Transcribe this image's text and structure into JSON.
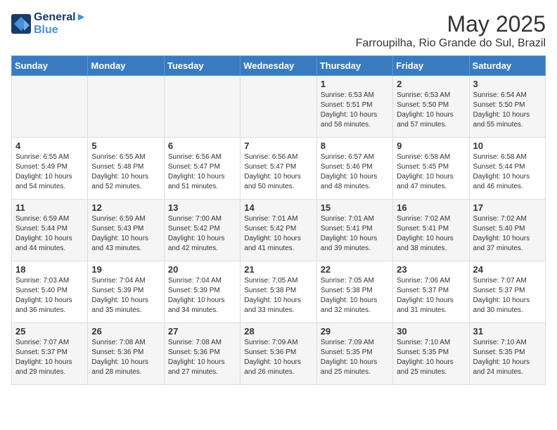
{
  "header": {
    "logo_line1": "General",
    "logo_line2": "Blue",
    "title": "May 2025",
    "subtitle": "Farroupilha, Rio Grande do Sul, Brazil"
  },
  "days_of_week": [
    "Sunday",
    "Monday",
    "Tuesday",
    "Wednesday",
    "Thursday",
    "Friday",
    "Saturday"
  ],
  "weeks": [
    [
      {
        "day": "",
        "info": ""
      },
      {
        "day": "",
        "info": ""
      },
      {
        "day": "",
        "info": ""
      },
      {
        "day": "",
        "info": ""
      },
      {
        "day": "1",
        "info": "Sunrise: 6:53 AM\nSunset: 5:51 PM\nDaylight: 10 hours\nand 58 minutes."
      },
      {
        "day": "2",
        "info": "Sunrise: 6:53 AM\nSunset: 5:50 PM\nDaylight: 10 hours\nand 57 minutes."
      },
      {
        "day": "3",
        "info": "Sunrise: 6:54 AM\nSunset: 5:50 PM\nDaylight: 10 hours\nand 55 minutes."
      }
    ],
    [
      {
        "day": "4",
        "info": "Sunrise: 6:55 AM\nSunset: 5:49 PM\nDaylight: 10 hours\nand 54 minutes."
      },
      {
        "day": "5",
        "info": "Sunrise: 6:55 AM\nSunset: 5:48 PM\nDaylight: 10 hours\nand 52 minutes."
      },
      {
        "day": "6",
        "info": "Sunrise: 6:56 AM\nSunset: 5:47 PM\nDaylight: 10 hours\nand 51 minutes."
      },
      {
        "day": "7",
        "info": "Sunrise: 6:56 AM\nSunset: 5:47 PM\nDaylight: 10 hours\nand 50 minutes."
      },
      {
        "day": "8",
        "info": "Sunrise: 6:57 AM\nSunset: 5:46 PM\nDaylight: 10 hours\nand 48 minutes."
      },
      {
        "day": "9",
        "info": "Sunrise: 6:58 AM\nSunset: 5:45 PM\nDaylight: 10 hours\nand 47 minutes."
      },
      {
        "day": "10",
        "info": "Sunrise: 6:58 AM\nSunset: 5:44 PM\nDaylight: 10 hours\nand 46 minutes."
      }
    ],
    [
      {
        "day": "11",
        "info": "Sunrise: 6:59 AM\nSunset: 5:44 PM\nDaylight: 10 hours\nand 44 minutes."
      },
      {
        "day": "12",
        "info": "Sunrise: 6:59 AM\nSunset: 5:43 PM\nDaylight: 10 hours\nand 43 minutes."
      },
      {
        "day": "13",
        "info": "Sunrise: 7:00 AM\nSunset: 5:42 PM\nDaylight: 10 hours\nand 42 minutes."
      },
      {
        "day": "14",
        "info": "Sunrise: 7:01 AM\nSunset: 5:42 PM\nDaylight: 10 hours\nand 41 minutes."
      },
      {
        "day": "15",
        "info": "Sunrise: 7:01 AM\nSunset: 5:41 PM\nDaylight: 10 hours\nand 39 minutes."
      },
      {
        "day": "16",
        "info": "Sunrise: 7:02 AM\nSunset: 5:41 PM\nDaylight: 10 hours\nand 38 minutes."
      },
      {
        "day": "17",
        "info": "Sunrise: 7:02 AM\nSunset: 5:40 PM\nDaylight: 10 hours\nand 37 minutes."
      }
    ],
    [
      {
        "day": "18",
        "info": "Sunrise: 7:03 AM\nSunset: 5:40 PM\nDaylight: 10 hours\nand 36 minutes."
      },
      {
        "day": "19",
        "info": "Sunrise: 7:04 AM\nSunset: 5:39 PM\nDaylight: 10 hours\nand 35 minutes."
      },
      {
        "day": "20",
        "info": "Sunrise: 7:04 AM\nSunset: 5:39 PM\nDaylight: 10 hours\nand 34 minutes."
      },
      {
        "day": "21",
        "info": "Sunrise: 7:05 AM\nSunset: 5:38 PM\nDaylight: 10 hours\nand 33 minutes."
      },
      {
        "day": "22",
        "info": "Sunrise: 7:05 AM\nSunset: 5:38 PM\nDaylight: 10 hours\nand 32 minutes."
      },
      {
        "day": "23",
        "info": "Sunrise: 7:06 AM\nSunset: 5:37 PM\nDaylight: 10 hours\nand 31 minutes."
      },
      {
        "day": "24",
        "info": "Sunrise: 7:07 AM\nSunset: 5:37 PM\nDaylight: 10 hours\nand 30 minutes."
      }
    ],
    [
      {
        "day": "25",
        "info": "Sunrise: 7:07 AM\nSunset: 5:37 PM\nDaylight: 10 hours\nand 29 minutes."
      },
      {
        "day": "26",
        "info": "Sunrise: 7:08 AM\nSunset: 5:36 PM\nDaylight: 10 hours\nand 28 minutes."
      },
      {
        "day": "27",
        "info": "Sunrise: 7:08 AM\nSunset: 5:36 PM\nDaylight: 10 hours\nand 27 minutes."
      },
      {
        "day": "28",
        "info": "Sunrise: 7:09 AM\nSunset: 5:36 PM\nDaylight: 10 hours\nand 26 minutes."
      },
      {
        "day": "29",
        "info": "Sunrise: 7:09 AM\nSunset: 5:35 PM\nDaylight: 10 hours\nand 25 minutes."
      },
      {
        "day": "30",
        "info": "Sunrise: 7:10 AM\nSunset: 5:35 PM\nDaylight: 10 hours\nand 25 minutes."
      },
      {
        "day": "31",
        "info": "Sunrise: 7:10 AM\nSunset: 5:35 PM\nDaylight: 10 hours\nand 24 minutes."
      }
    ]
  ]
}
